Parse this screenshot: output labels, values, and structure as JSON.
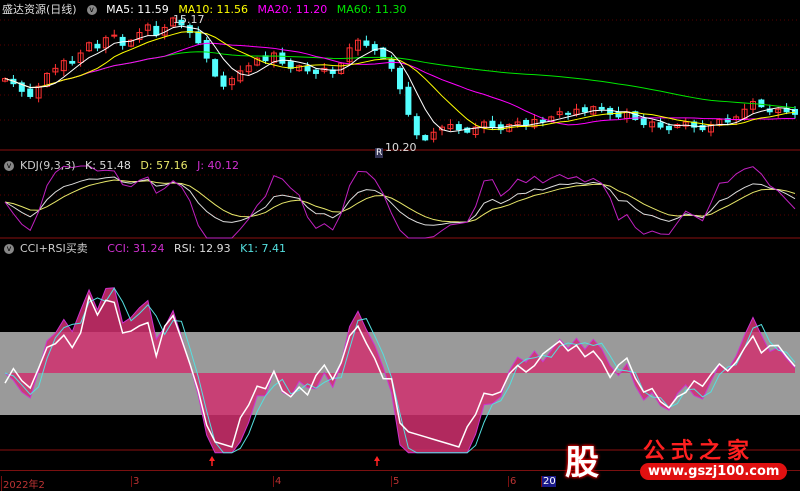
{
  "header": {
    "title": "盛达资源(日线)",
    "ma5": "MA5: 11.59",
    "ma10": "MA10: 11.56",
    "ma20": "MA20: 11.20",
    "ma60": "MA60: 11.30",
    "high_label": "15.17",
    "low_label": "10.20",
    "marker": "R"
  },
  "kdj": {
    "title": "KDJ(9,3,3)",
    "k": "K: 51.48",
    "d": "D: 57.16",
    "j": "J: 40.12"
  },
  "cci": {
    "title": "CCI+RSI买卖",
    "cci": "CCI: 31.24",
    "rsi": "RSI: 12.93",
    "k1": "K1: 7.41"
  },
  "axis": {
    "ticks": [
      "2022年2",
      "3",
      "4",
      "5",
      "6",
      "20"
    ]
  },
  "watermark": {
    "brand": "股",
    "name": "公式之家",
    "url": "www.gszj100.com"
  },
  "colors": {
    "up": "#ff3232",
    "down": "#54ffff",
    "ma5": "#ffffff",
    "ma10": "#ffff00",
    "ma20": "#ff00ff",
    "ma60": "#00e600",
    "band": "#9a9a9a"
  },
  "chart_data": {
    "type": "candlestick",
    "closes": [
      12.8,
      12.6,
      12.3,
      12.1,
      12.5,
      13.0,
      13.2,
      13.5,
      13.4,
      13.8,
      14.2,
      14.0,
      14.4,
      14.5,
      14.1,
      14.3,
      14.6,
      14.9,
      14.5,
      14.8,
      15.17,
      14.9,
      14.6,
      14.2,
      13.6,
      12.9,
      12.5,
      12.8,
      13.1,
      13.3,
      13.6,
      13.5,
      13.8,
      13.4,
      13.2,
      13.3,
      13.1,
      13.0,
      13.2,
      13.0,
      13.4,
      14.0,
      14.3,
      14.1,
      13.9,
      13.6,
      13.2,
      12.4,
      11.4,
      10.6,
      10.4,
      10.7,
      10.9,
      11.0,
      10.8,
      10.7,
      10.9,
      11.1,
      10.9,
      10.8,
      11.0,
      11.1,
      11.0,
      11.2,
      11.1,
      11.3,
      11.5,
      11.4,
      11.6,
      11.5,
      11.7,
      11.6,
      11.4,
      11.3,
      11.5,
      11.2,
      11.0,
      11.1,
      10.9,
      10.8,
      11.0,
      11.1,
      10.9,
      10.8,
      11.0,
      11.2,
      11.1,
      11.3,
      11.6,
      11.9,
      11.7,
      11.5,
      11.6,
      11.5,
      11.4
    ]
  }
}
